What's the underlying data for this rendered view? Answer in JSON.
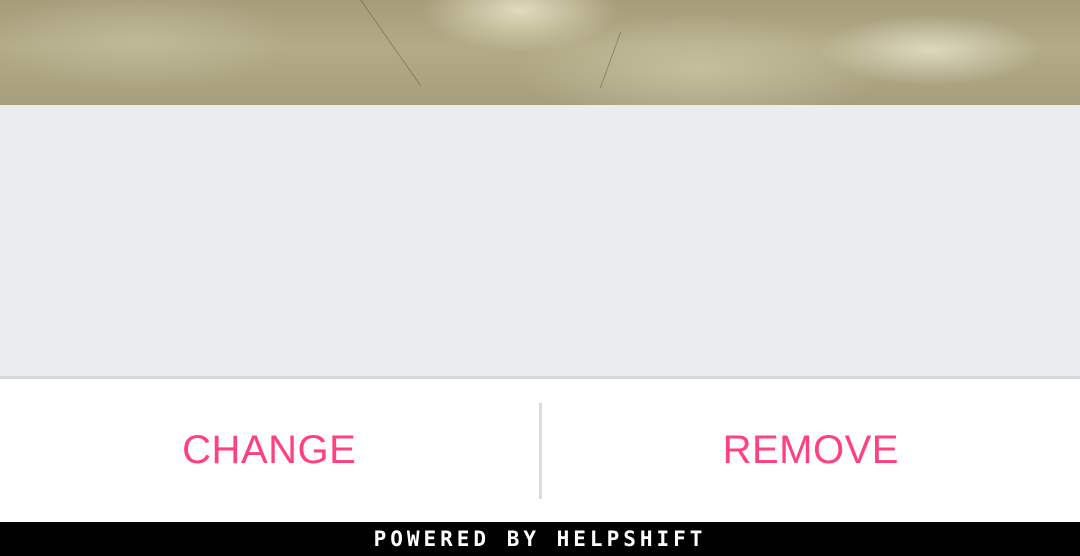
{
  "photo": {
    "description": "attachment-image-preview"
  },
  "actions": {
    "change_label": "CHANGE",
    "remove_label": "REMOVE",
    "accent_color": "#ff4081"
  },
  "footer": {
    "text": "POWERED BY HELPSHIFT"
  }
}
